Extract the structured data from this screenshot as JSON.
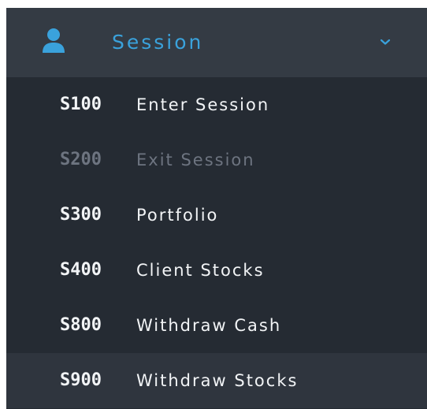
{
  "colors": {
    "accent": "#3aa2dc",
    "header_background": "#343b44",
    "menu_background": "#252b33",
    "active_item_background": "#2f353e",
    "text": "#f2f4f6",
    "disabled_text": "#6d7480"
  },
  "header": {
    "icon": "user-icon",
    "label": "Session",
    "toggle_icon": "chevron-down-icon",
    "expanded": true
  },
  "menu": {
    "items": [
      {
        "code": "S100",
        "label": "Enter Session",
        "disabled": false,
        "active": false
      },
      {
        "code": "S200",
        "label": "Exit Session",
        "disabled": true,
        "active": false
      },
      {
        "code": "S300",
        "label": "Portfolio",
        "disabled": false,
        "active": false
      },
      {
        "code": "S400",
        "label": "Client Stocks",
        "disabled": false,
        "active": false
      },
      {
        "code": "S800",
        "label": "Withdraw Cash",
        "disabled": false,
        "active": false
      },
      {
        "code": "S900",
        "label": "Withdraw Stocks",
        "disabled": false,
        "active": true
      }
    ]
  }
}
